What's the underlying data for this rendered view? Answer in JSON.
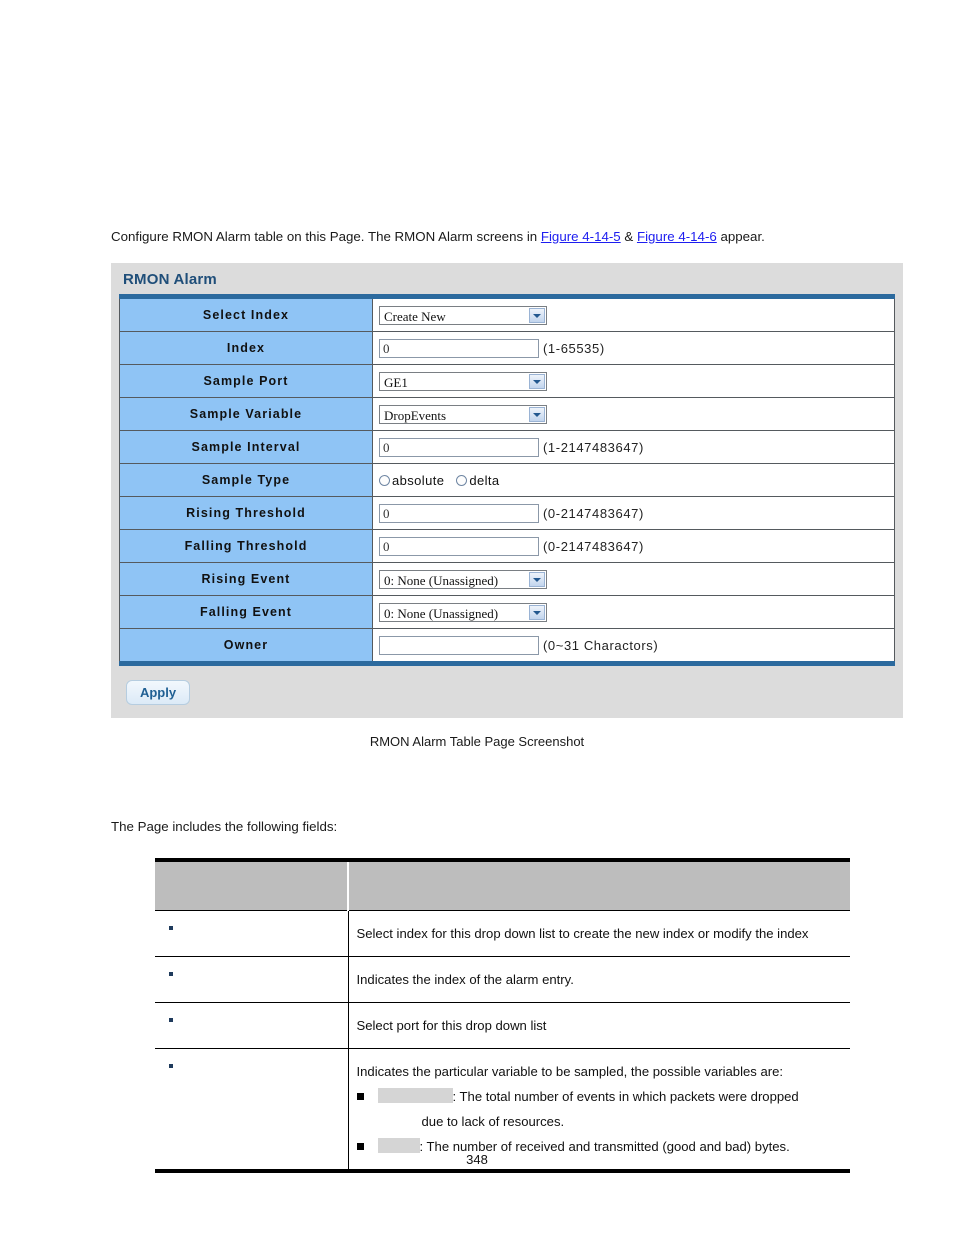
{
  "intro": {
    "before": "Configure RMON Alarm table on this Page. The RMON Alarm screens in ",
    "link1": "Figure 4-14-5",
    "amp": " & ",
    "link2": "Figure 4-14-6",
    "after": " appear."
  },
  "panel": {
    "title": "RMON Alarm",
    "apply_label": "Apply",
    "rows": [
      {
        "label": "Select Index",
        "control": "select",
        "value": "Create New",
        "hint": ""
      },
      {
        "label": "Index",
        "control": "text",
        "value": "0",
        "hint": "(1-65535)"
      },
      {
        "label": "Sample Port",
        "control": "select",
        "value": "GE1",
        "hint": ""
      },
      {
        "label": "Sample Variable",
        "control": "select",
        "value": "DropEvents",
        "hint": ""
      },
      {
        "label": "Sample Interval",
        "control": "text",
        "value": "0",
        "hint": "(1-2147483647)"
      },
      {
        "label": "Sample Type",
        "control": "radio",
        "value": "",
        "hint": ""
      },
      {
        "label": "Rising Threshold",
        "control": "text",
        "value": "0",
        "hint": "(0-2147483647)"
      },
      {
        "label": "Falling Threshold",
        "control": "text",
        "value": "0",
        "hint": "(0-2147483647)"
      },
      {
        "label": "Rising Event",
        "control": "select",
        "value": "0: None (Unassigned)",
        "hint": ""
      },
      {
        "label": "Falling Event",
        "control": "select",
        "value": "0: None (Unassigned)",
        "hint": ""
      },
      {
        "label": "Owner",
        "control": "text",
        "value": "",
        "hint": "(0~31 Charactors)"
      }
    ],
    "sample_type": {
      "option1": "absolute",
      "option2": "delta"
    }
  },
  "caption": "RMON Alarm Table Page Screenshot",
  "includes_text": "The Page includes the following fields:",
  "fields_table": {
    "header": {
      "col1": "",
      "col2": ""
    },
    "rows": [
      {
        "name": "",
        "desc": "Select index for this drop down list to create the new index or modify the index"
      },
      {
        "name": "",
        "desc": "Indicates the index of the alarm entry."
      },
      {
        "name": "",
        "desc": "Select port for this drop down list"
      }
    ],
    "last_row": {
      "name": "",
      "desc_intro": "Indicates the particular variable to be sampled, the possible variables are:",
      "bullet1_after": ": The total number of events in which packets were dropped",
      "bullet1_cont": "due to lack of resources.",
      "bullet2_after": ": The number of received and transmitted (good and bad) bytes."
    }
  },
  "page_number": "348"
}
